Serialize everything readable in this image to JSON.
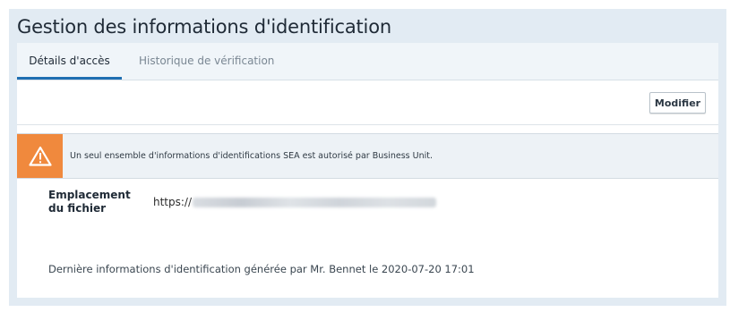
{
  "panel": {
    "title": "Gestion des informations d'identification"
  },
  "tabs": [
    {
      "label": "Détails d'accès",
      "active": true
    },
    {
      "label": "Historique de vérification",
      "active": false
    }
  ],
  "toolbar": {
    "edit_label": "Modifier"
  },
  "alert": {
    "icon": "warning-triangle-icon",
    "color": "#f0893d",
    "text": "Un seul ensemble d'informations d'identifications SEA est autorisé par Business Unit."
  },
  "file_location": {
    "label": "Emplacement du fichier",
    "value_prefix": "https://"
  },
  "footer": {
    "text": "Dernière informations d'identification générée par Mr. Bennet le 2020-07-20 17:01"
  },
  "colors": {
    "accent": "#1f6fb2",
    "panel_bg": "#e2ebf3"
  }
}
